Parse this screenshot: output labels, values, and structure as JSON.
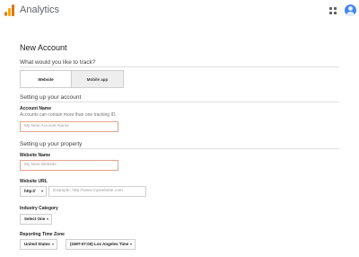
{
  "header": {
    "app_title": "Analytics",
    "logo_icon": "analytics-logo-icon",
    "apps_icon": "apps-grid-icon",
    "avatar_icon": "account-avatar-icon",
    "accent_color": "#f9ab00"
  },
  "page": {
    "title": "New Account"
  },
  "track": {
    "question": "What would you like to track?",
    "options": [
      {
        "label": "Website",
        "selected": true
      },
      {
        "label": "Mobile app",
        "selected": false
      }
    ]
  },
  "account": {
    "section_title": "Setting up your account",
    "name_label": "Account Name",
    "name_helper": "Accounts can contain more than one tracking ID.",
    "name_placeholder": "My New Account Name"
  },
  "property": {
    "section_title": "Setting up your property",
    "website_name_label": "Website Name",
    "website_name_placeholder": "My New Website",
    "url_label": "Website URL",
    "url_protocol": "http://",
    "url_placeholder": "Example: http://www.mywebsite.com",
    "category_label": "Industry Category",
    "category_value": "Select One",
    "timezone_label": "Reporting Time Zone",
    "timezone_country": "United States",
    "timezone_value": "(GMT-07:00) Los Angeles Time"
  }
}
